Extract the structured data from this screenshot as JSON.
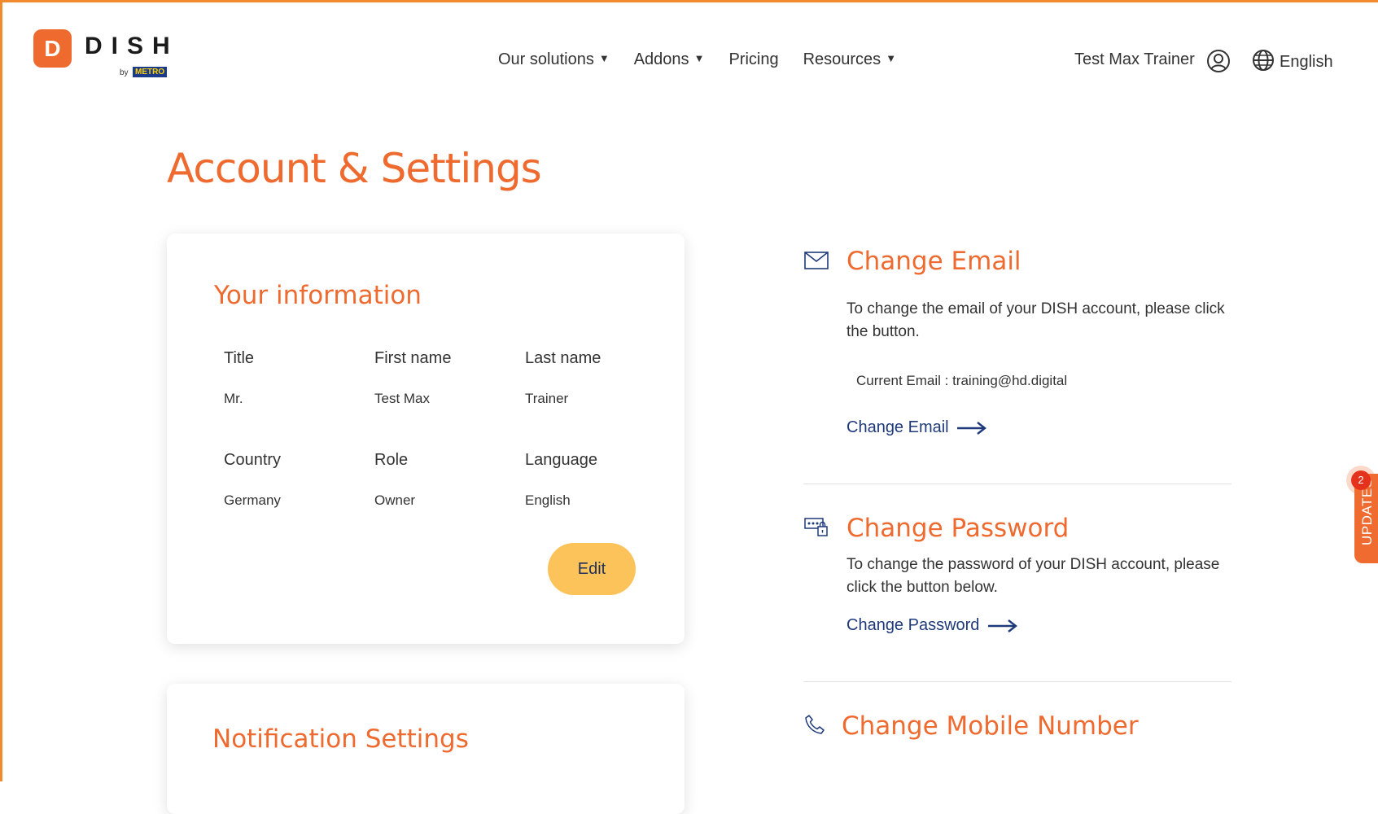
{
  "brand": {
    "logo_letter": "D",
    "name": "DISH",
    "by": "by",
    "partner": "METRO"
  },
  "nav": {
    "items": [
      {
        "label": "Our solutions",
        "has_dropdown": true
      },
      {
        "label": "Addons",
        "has_dropdown": true
      },
      {
        "label": "Pricing",
        "has_dropdown": false
      },
      {
        "label": "Resources",
        "has_dropdown": true
      }
    ],
    "caret": "▼"
  },
  "user": {
    "name": "Test Max Trainer",
    "icon": "user-circle-icon"
  },
  "language": {
    "label": "English",
    "icon": "globe-icon"
  },
  "page": {
    "title": "Account & Settings"
  },
  "info_card": {
    "title": "Your information",
    "fields": {
      "title": {
        "label": "Title",
        "value": "Mr."
      },
      "first_name": {
        "label": "First name",
        "value": "Test Max"
      },
      "last_name": {
        "label": "Last name",
        "value": "Trainer"
      },
      "country": {
        "label": "Country",
        "value": "Germany"
      },
      "role": {
        "label": "Role",
        "value": "Owner"
      },
      "language": {
        "label": "Language",
        "value": "English"
      }
    },
    "edit_label": "Edit"
  },
  "notification_card": {
    "title": "Notification Settings"
  },
  "email_section": {
    "icon": "envelope-icon",
    "title": "Change Email",
    "text": "To change the email of your DISH account, please click the button.",
    "current": "Current Email : training@hd.digital",
    "link": "Change Email"
  },
  "password_section": {
    "icon": "password-lock-icon",
    "title": "Change Password",
    "text": "To change the password of your DISH account, please click the button below.",
    "link": "Change Password"
  },
  "mobile_section": {
    "icon": "phone-icon",
    "title": "Change Mobile Number"
  },
  "updates": {
    "label": "UPDATES",
    "count": "2"
  },
  "colors": {
    "accent": "#ee6a2f",
    "button": "#fbc35a",
    "link": "#1f3a7a",
    "frame": "#f08a2c"
  }
}
